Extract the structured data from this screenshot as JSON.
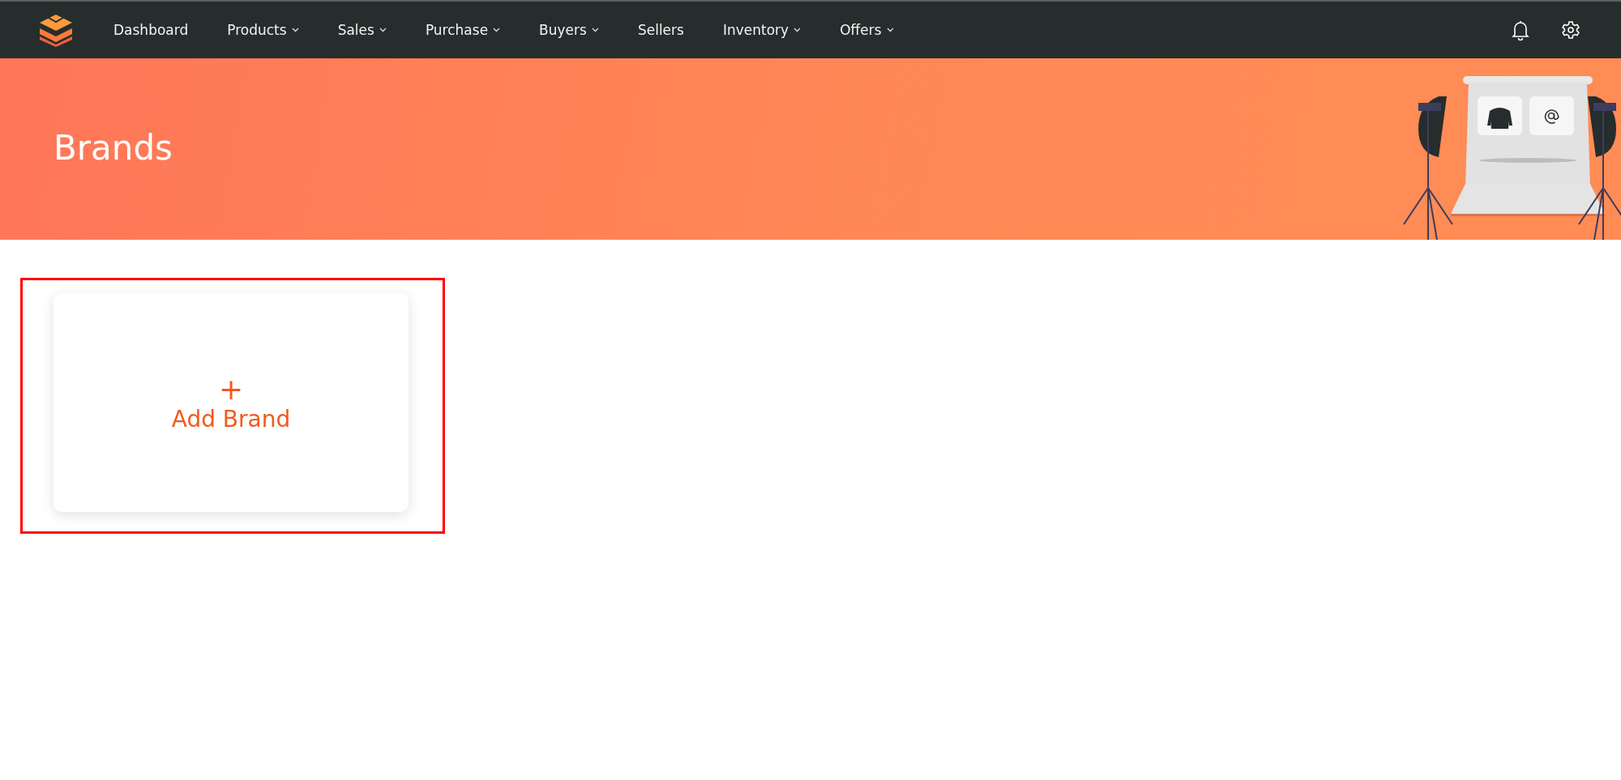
{
  "nav": {
    "items": [
      {
        "label": "Dashboard",
        "has_dropdown": false
      },
      {
        "label": "Products",
        "has_dropdown": true
      },
      {
        "label": "Sales",
        "has_dropdown": true
      },
      {
        "label": "Purchase",
        "has_dropdown": true
      },
      {
        "label": "Buyers",
        "has_dropdown": true
      },
      {
        "label": "Sellers",
        "has_dropdown": false
      },
      {
        "label": "Inventory",
        "has_dropdown": true
      },
      {
        "label": "Offers",
        "has_dropdown": true
      }
    ]
  },
  "banner": {
    "title": "Brands"
  },
  "add_card": {
    "icon": "+",
    "label": "Add Brand",
    "highlighted": true
  }
}
